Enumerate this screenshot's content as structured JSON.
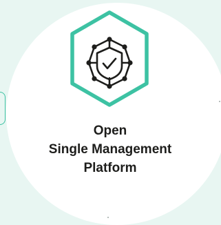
{
  "product": {
    "title_lines": [
      "Open",
      "Single Management",
      "Platform"
    ]
  },
  "colors": {
    "background": "#e8f6f2",
    "accent": "#3dc2a3",
    "text": "#1d1d1b"
  },
  "icon": "hexagon-shield-network-icon"
}
